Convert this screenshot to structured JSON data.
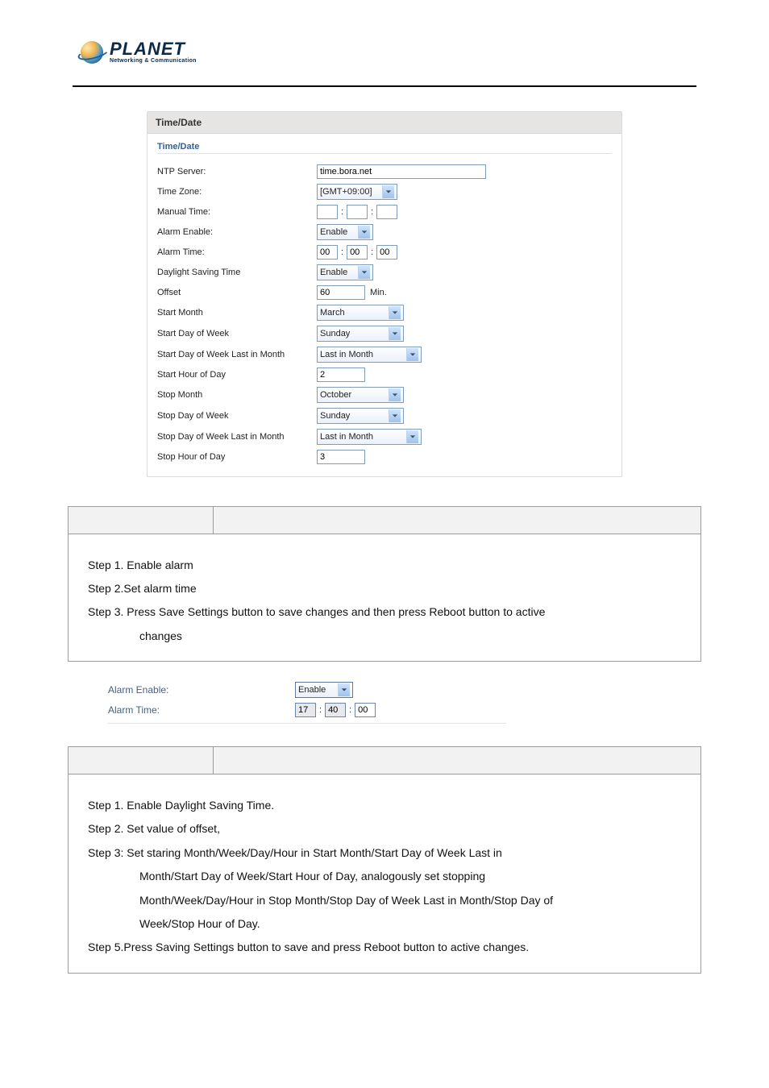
{
  "logo": {
    "main": "PLANET",
    "sub": "Networking & Communication"
  },
  "panel": {
    "title": "Time/Date",
    "fieldset": "Time/Date",
    "labels": {
      "ntp": "NTP Server:",
      "tz": "Time Zone:",
      "manual": "Manual Time:",
      "aen": "Alarm Enable:",
      "atime": "Alarm Time:",
      "dst": "Daylight Saving Time",
      "offset": "Offset",
      "smonth": "Start Month",
      "sdow": "Start Day of Week",
      "sdowl": "Start Day of Week Last in Month",
      "shod": "Start Hour of Day",
      "emonth": "Stop Month",
      "edow": "Stop Day of Week",
      "edowl": "Stop Day of Week Last in Month",
      "ehod": "Stop Hour of Day"
    },
    "values": {
      "ntp": "time.bora.net",
      "tz": "[GMT+09:00]",
      "manual_h": "",
      "manual_m": "",
      "manual_s": "",
      "aen": "Enable",
      "atime_h": "00",
      "atime_m": "00",
      "atime_s": "00",
      "dst": "Enable",
      "offset": "60",
      "offset_unit": "Min.",
      "smonth": "March",
      "sdow": "Sunday",
      "sdowl": "Last in Month",
      "shod": "2",
      "emonth": "October",
      "edow": "Sunday",
      "edowl": "Last in Month",
      "ehod": "3"
    }
  },
  "box1": {
    "lines": [
      "Step 1. Enable alarm",
      "Step 2.Set alarm time",
      "Step 3. Press Save Settings button to save changes and then press Reboot button to active"
    ],
    "lines_indent": [
      "changes"
    ]
  },
  "alarm_sample": {
    "labels": {
      "aen": "Alarm Enable:",
      "atime": "Alarm Time:"
    },
    "values": {
      "aen": "Enable",
      "h": "17",
      "m": "40",
      "s": "00"
    }
  },
  "box2": {
    "lines": [
      "Step 1. Enable Daylight Saving Time.",
      "Step 2. Set value of offset,",
      "Step 3: Set staring Month/Week/Day/Hour in Start Month/Start Day of Week Last in"
    ],
    "lines_indent": [
      "Month/Start Day of Week/Start Hour of Day, analogously set stopping",
      "Month/Week/Day/Hour in Stop Month/Stop Day of Week Last in Month/Stop Day of",
      "Week/Stop Hour of Day."
    ],
    "last": "Step 5.Press Saving Settings button to save and press Reboot button to active changes."
  }
}
